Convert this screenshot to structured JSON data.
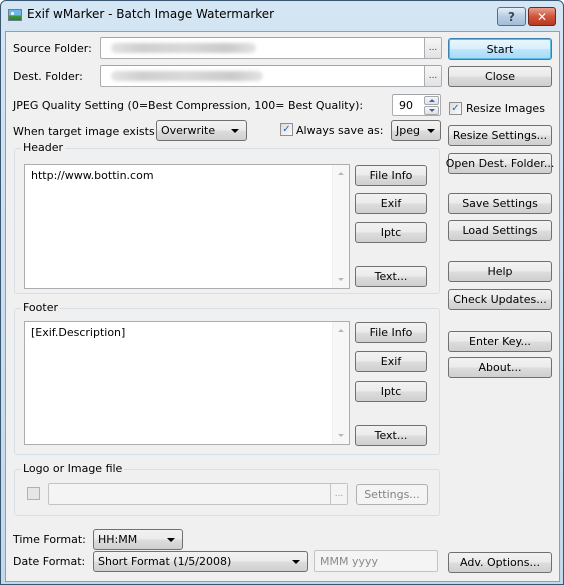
{
  "window": {
    "title": "Exif wMarker - Batch Image Watermarker",
    "help_glyph": "?",
    "close_glyph": "✕"
  },
  "source": {
    "label": "Source Folder:",
    "browse": "..."
  },
  "dest": {
    "label": "Dest. Folder:",
    "browse": "..."
  },
  "quality": {
    "label": "JPEG Quality Setting (0=Best Compression, 100= Best Quality):",
    "value": "90"
  },
  "exists": {
    "label": "When target image exists:",
    "selected": "Overwrite"
  },
  "always_save": {
    "label": "Always save as:",
    "checked": true,
    "selected": "Jpeg"
  },
  "resize": {
    "label": "Resize Images",
    "checked": true
  },
  "header": {
    "label": "Header",
    "text": "http://www.bottin.com",
    "buttons": {
      "file_info": "File Info",
      "exif": "Exif",
      "iptc": "Iptc",
      "text": "Text..."
    }
  },
  "footer": {
    "label": "Footer",
    "text": "[Exif.Description]",
    "buttons": {
      "file_info": "File Info",
      "exif": "Exif",
      "iptc": "Iptc",
      "text": "Text..."
    }
  },
  "logo": {
    "label": "Logo or Image file",
    "checked": false,
    "browse": "...",
    "settings": "Settings..."
  },
  "time_format": {
    "label": "Time Format:",
    "selected": "HH:MM"
  },
  "date_format": {
    "label": "Date Format:",
    "selected": "Short Format (1/5/2008)",
    "custom_placeholder": "MMM yyyy"
  },
  "side_buttons": {
    "start": "Start",
    "close": "Close",
    "resize_settings": "Resize Settings...",
    "open_dest": "Open Dest. Folder...",
    "save_settings": "Save Settings",
    "load_settings": "Load Settings",
    "help": "Help",
    "check_updates": "Check Updates...",
    "enter_key": "Enter Key...",
    "about": "About...",
    "adv_options": "Adv. Options..."
  }
}
